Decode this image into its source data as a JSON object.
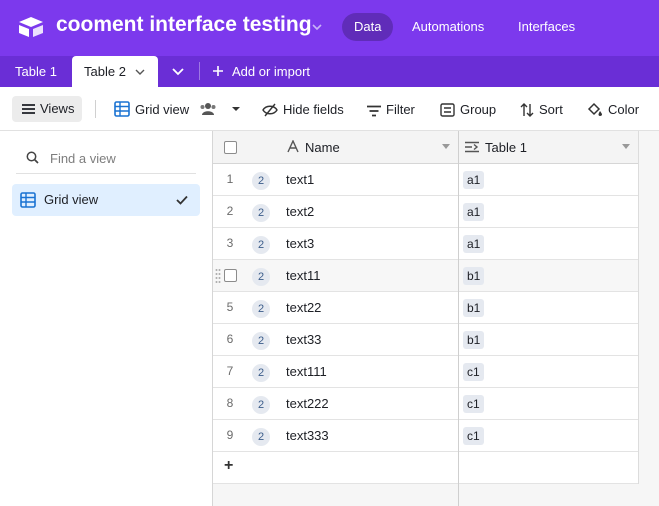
{
  "header": {
    "base_title": "cooment interface testing",
    "nav": [
      "Data",
      "Automations",
      "Interfaces"
    ],
    "active_nav": "Data",
    "brand_color": "#7c39ed"
  },
  "tabs": {
    "items": [
      "Table 1",
      "Table 2"
    ],
    "active": "Table 2",
    "add_label": "Add or import"
  },
  "toolbar": {
    "views_label": "Views",
    "view_name": "Grid view",
    "hide_fields": "Hide fields",
    "filter": "Filter",
    "group": "Group",
    "sort": "Sort",
    "color": "Color"
  },
  "sidebar": {
    "search_placeholder": "Find a view",
    "views": [
      {
        "label": "Grid view",
        "selected": true
      }
    ]
  },
  "grid": {
    "columns": [
      "Name",
      "Table 1"
    ],
    "rows": [
      {
        "num": "1",
        "badge": "2",
        "name": "text1",
        "link": "a1"
      },
      {
        "num": "2",
        "badge": "2",
        "name": "text2",
        "link": "a1"
      },
      {
        "num": "3",
        "badge": "2",
        "name": "text3",
        "link": "a1"
      },
      {
        "num": "",
        "badge": "2",
        "name": "text11",
        "link": "b1"
      },
      {
        "num": "5",
        "badge": "2",
        "name": "text22",
        "link": "b1"
      },
      {
        "num": "6",
        "badge": "2",
        "name": "text33",
        "link": "b1"
      },
      {
        "num": "7",
        "badge": "2",
        "name": "text111",
        "link": "c1"
      },
      {
        "num": "8",
        "badge": "2",
        "name": "text222",
        "link": "c1"
      },
      {
        "num": "9",
        "badge": "2",
        "name": "text333",
        "link": "c1"
      }
    ],
    "add_row_label": "+"
  }
}
